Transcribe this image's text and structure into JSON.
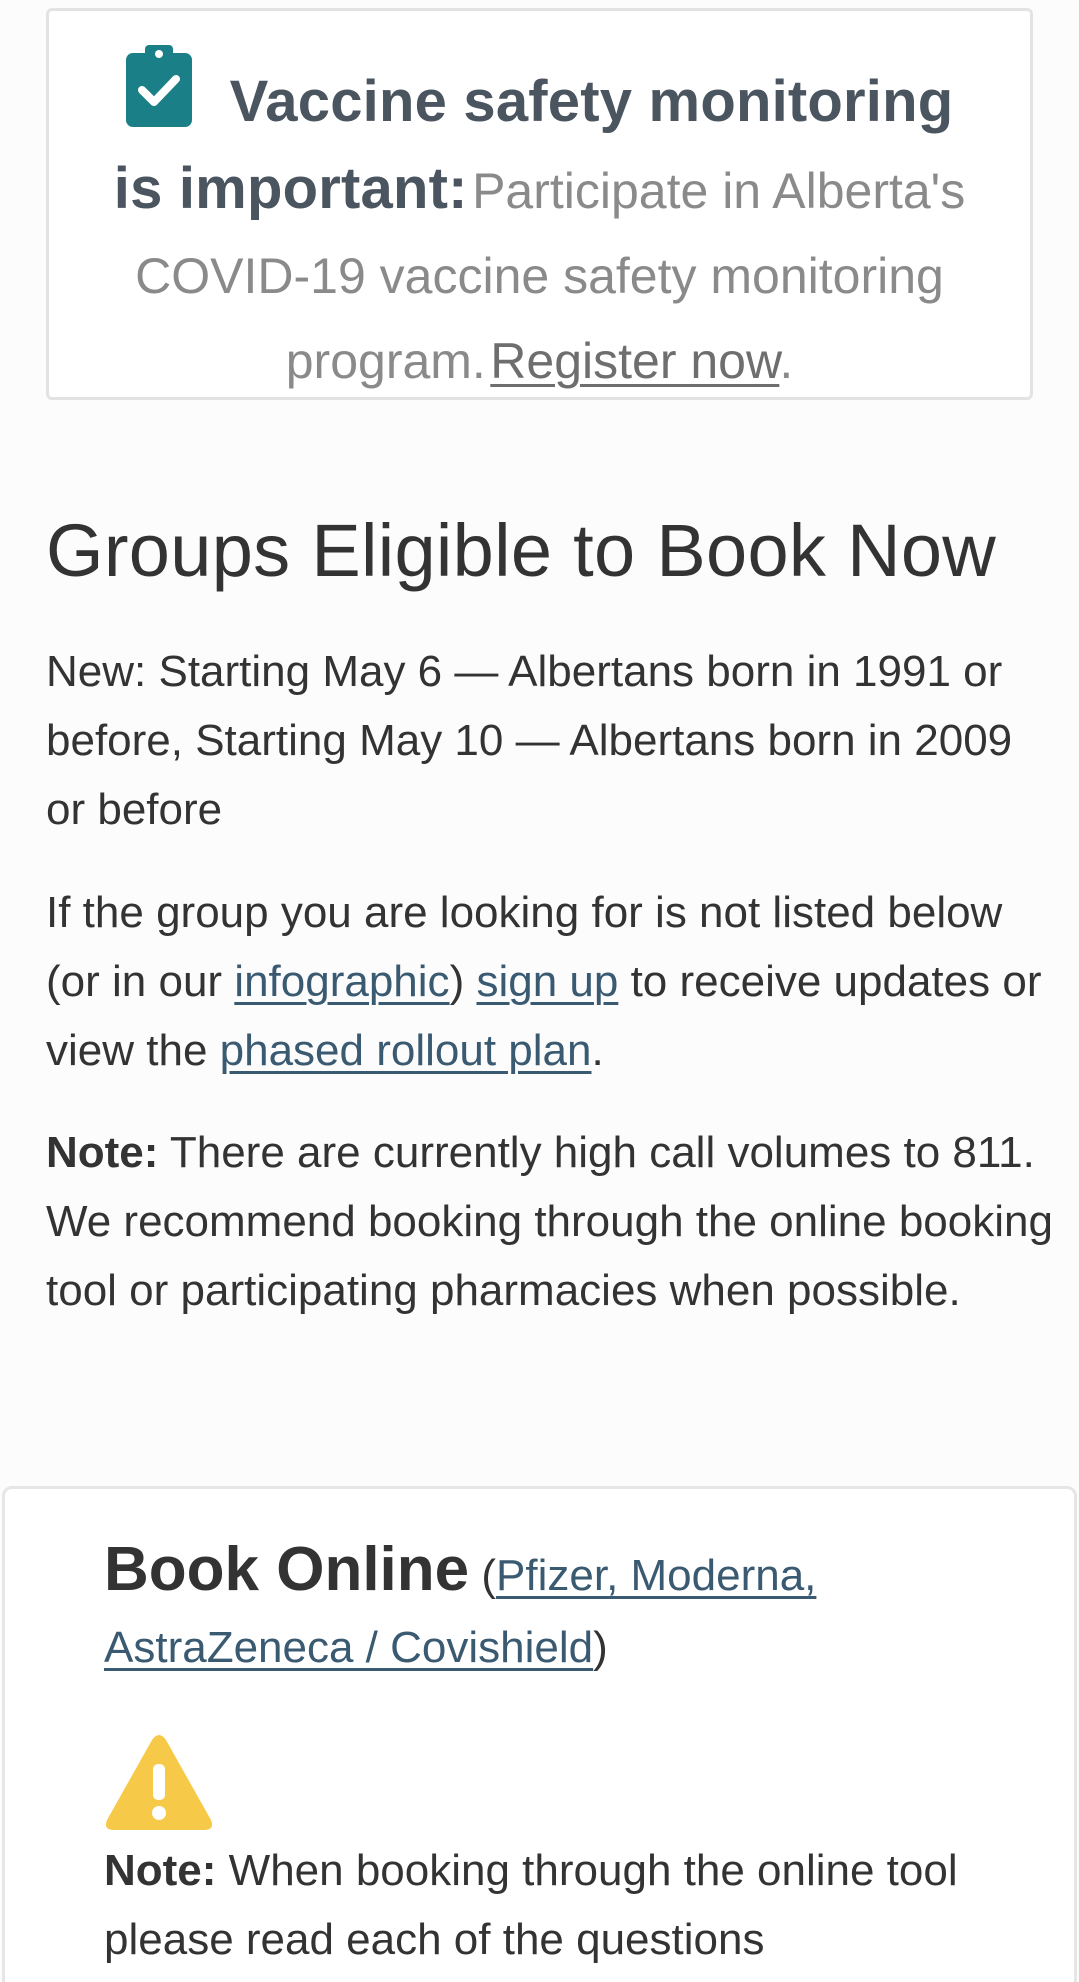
{
  "banner": {
    "icon": "clipboard-check-icon",
    "title_line1": "Vaccine safety monitoring",
    "title_line2": "is important:",
    "text_part1": "Participate in Alberta's",
    "text_part2": "COVID-19 vaccine safety monitoring",
    "text_part3": "program.",
    "link_label": "Register now",
    "trailing": ".",
    "icon_color": "#1a7f86"
  },
  "groups": {
    "heading": "Groups Eligible to Book Now",
    "new_notice": "New: Starting May 6 — Albertans born in 1991 or before, Starting May 10 — Albertans born in 2009 or before",
    "info": {
      "text1": "If the group you are looking for is not listed below (or in our ",
      "link_infographic": "infographic",
      "text2": ") ",
      "link_signup": "sign up",
      "text3": " to receive updates or view the ",
      "link_rollout": "phased rollout plan",
      "text4": "."
    },
    "call_note": {
      "label": "Note:",
      "text": " There are currently high call volumes to 811. We recommend booking through the online booking tool or participating pharmacies when possible."
    }
  },
  "book_online": {
    "title": "Book Online",
    "paren_open": " (",
    "vaccines_link": "Pfizer, Moderna, AstraZeneca / Covishield",
    "paren_close": ")",
    "warning_icon": "warning-triangle-icon",
    "warning_color": "#f7c948",
    "note_label": "Note:",
    "note_text": " When booking through the online tool please read each of the questions"
  }
}
